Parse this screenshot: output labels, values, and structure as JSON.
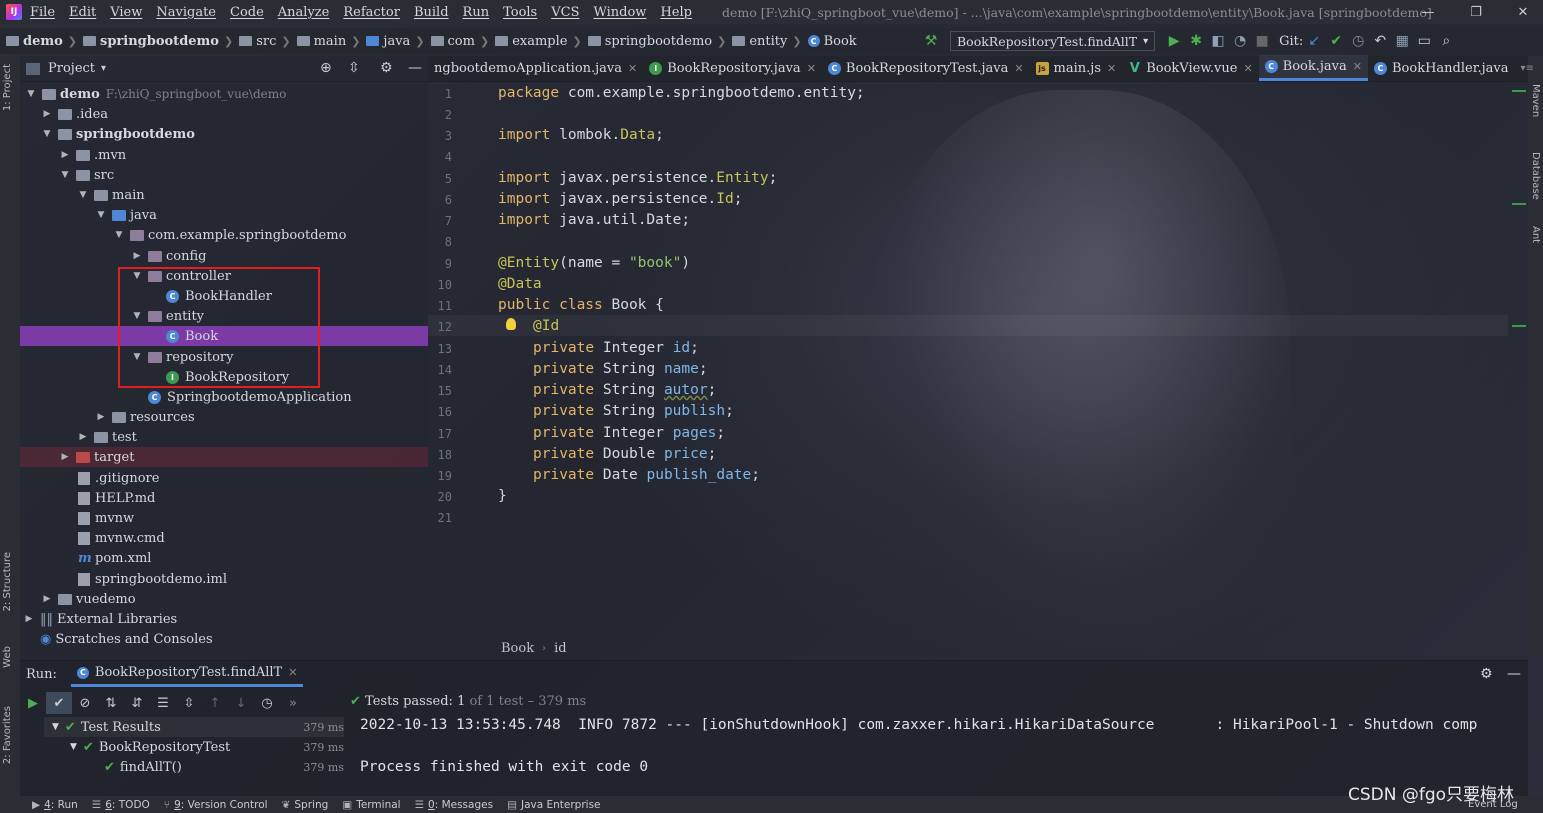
{
  "menubar": {
    "items": [
      "File",
      "Edit",
      "View",
      "Navigate",
      "Code",
      "Analyze",
      "Refactor",
      "Build",
      "Run",
      "Tools",
      "VCS",
      "Window",
      "Help"
    ],
    "window_title": "demo [F:\\zhiQ_springboot_vue\\demo] - ...\\java\\com\\example\\springbootdemo\\entity\\Book.java [springbootdemo]"
  },
  "breadcrumbs": [
    "demo",
    "springbootdemo",
    "src",
    "main",
    "java",
    "com",
    "example",
    "springbootdemo",
    "entity",
    "Book"
  ],
  "run_config": "BookRepositoryTest.findAllT",
  "git_label": "Git:",
  "project_panel": {
    "title": "Project",
    "tree": [
      {
        "label": "demo",
        "path": "F:\\zhiQ_springboot_vue\\demo",
        "arrow": "▼",
        "icon": "folder"
      },
      {
        "label": ".idea",
        "arrow": "▶",
        "icon": "folder"
      },
      {
        "label": "springbootdemo",
        "arrow": "▼",
        "icon": "folder"
      },
      {
        "label": ".mvn",
        "arrow": "▶",
        "icon": "folder"
      },
      {
        "label": "src",
        "arrow": "▼",
        "icon": "folder"
      },
      {
        "label": "main",
        "arrow": "▼",
        "icon": "folder"
      },
      {
        "label": "java",
        "arrow": "▼",
        "icon": "folder"
      },
      {
        "label": "com.example.springbootdemo",
        "arrow": "▼",
        "icon": "package"
      },
      {
        "label": "config",
        "arrow": "▶",
        "icon": "package"
      },
      {
        "label": "controller",
        "arrow": "▼",
        "icon": "package"
      },
      {
        "label": "BookHandler",
        "arrow": "",
        "icon": "C"
      },
      {
        "label": "entity",
        "arrow": "▼",
        "icon": "package"
      },
      {
        "label": "Book",
        "arrow": "",
        "icon": "C"
      },
      {
        "label": "repository",
        "arrow": "▼",
        "icon": "package"
      },
      {
        "label": "BookRepository",
        "arrow": "",
        "icon": "I"
      },
      {
        "label": "SpringbootdemoApplication",
        "arrow": "",
        "icon": "C"
      },
      {
        "label": "resources",
        "arrow": "▶",
        "icon": "folder"
      },
      {
        "label": "test",
        "arrow": "▶",
        "icon": "folder"
      },
      {
        "label": "target",
        "arrow": "▶",
        "icon": "folder"
      },
      {
        "label": ".gitignore",
        "arrow": "",
        "icon": "file"
      },
      {
        "label": "HELP.md",
        "arrow": "",
        "icon": "file"
      },
      {
        "label": "mvnw",
        "arrow": "",
        "icon": "file"
      },
      {
        "label": "mvnw.cmd",
        "arrow": "",
        "icon": "file"
      },
      {
        "label": "pom.xml",
        "arrow": "",
        "icon": "m"
      },
      {
        "label": "springbootdemo.iml",
        "arrow": "",
        "icon": "file"
      },
      {
        "label": "vuedemo",
        "arrow": "▶",
        "icon": "folder"
      },
      {
        "label": "External Libraries",
        "arrow": "▶",
        "icon": "lib"
      },
      {
        "label": "Scratches and Consoles",
        "arrow": "",
        "icon": "scratch"
      }
    ]
  },
  "editor_tabs": [
    {
      "label": "ngbootdemoApplication.java",
      "icon": ""
    },
    {
      "label": "BookRepository.java",
      "icon": "I"
    },
    {
      "label": "BookRepositoryTest.java",
      "icon": "C"
    },
    {
      "label": "main.js",
      "icon": "js"
    },
    {
      "label": "BookView.vue",
      "icon": "V"
    },
    {
      "label": "Book.java",
      "icon": "C"
    },
    {
      "label": "BookHandler.java",
      "icon": "C"
    }
  ],
  "code": {
    "line_numbers": [
      "1",
      "2",
      "3",
      "4",
      "5",
      "6",
      "7",
      "8",
      "9",
      "10",
      "11",
      "12",
      "13",
      "14",
      "15",
      "16",
      "17",
      "18",
      "19",
      "20",
      "21"
    ],
    "l1_kw": "package",
    "l1_rest": " com.example.springbootdemo.entity;",
    "l3_kw": "import",
    "l3_a": " lombok.",
    "l3_b": "Data",
    "l3_c": ";",
    "l5_kw": "import",
    "l5_a": " javax.persistence.",
    "l5_b": "Entity",
    "l5_c": ";",
    "l6_kw": "import",
    "l6_a": " javax.persistence.",
    "l6_b": "Id",
    "l6_c": ";",
    "l7_kw": "import",
    "l7_a": " java.util.Date;",
    "l9_ann": "@Entity",
    "l9_a": "(name = ",
    "l9_str": "\"book\"",
    "l9_c": ")",
    "l10_ann": "@Data",
    "l11_kw": "public class",
    "l11_a": " Book {",
    "l12_ann": "@Id",
    "fields": [
      {
        "mod": "private",
        "type": " Integer ",
        "name": "id",
        "end": ";"
      },
      {
        "mod": "private",
        "type": " String ",
        "name": "name",
        "end": ";"
      },
      {
        "mod": "private",
        "type": " String ",
        "name": "autor",
        "end": ";"
      },
      {
        "mod": "private",
        "type": " String ",
        "name": "publish",
        "end": ";"
      },
      {
        "mod": "private",
        "type": " Integer ",
        "name": "pages",
        "end": ";"
      },
      {
        "mod": "private",
        "type": " Double ",
        "name": "price",
        "end": ";"
      },
      {
        "mod": "private",
        "type": " Date ",
        "name": "publish_date",
        "end": ";"
      }
    ],
    "l20": "}"
  },
  "editor_crumbs": [
    "Book",
    "id"
  ],
  "run_panel": {
    "label": "Run:",
    "tab": "BookRepositoryTest.findAllT",
    "passed_label": "Tests passed:",
    "passed_count": "1",
    "passed_rest": "of 1 test",
    "passed_time": "– 379 ms",
    "tests": [
      {
        "label": "Test Results",
        "ms": "379 ms"
      },
      {
        "label": "BookRepositoryTest",
        "ms": "379 ms"
      },
      {
        "label": "findAllT()",
        "ms": "379 ms"
      }
    ],
    "console_line1": "2022-10-13 13:53:45.748  INFO 7872 --- [ionShutdownHook] com.zaxxer.hikari.HikariDataSource       : HikariPool-1 - Shutdown comp",
    "console_line2": "Process finished with exit code 0"
  },
  "left_strip": [
    "1: Project",
    "2: Structure",
    "Web",
    "2: Favorites"
  ],
  "right_strip": [
    "Maven",
    "Database",
    "Ant"
  ],
  "bottom_bar": [
    {
      "num": "4",
      "label": ": Run"
    },
    {
      "num": "6",
      "label": ": TODO"
    },
    {
      "num": "9",
      "label": ": Version Control"
    },
    {
      "num": "",
      "label": "Spring"
    },
    {
      "num": "",
      "label": "Terminal"
    },
    {
      "num": "0",
      "label": ": Messages"
    },
    {
      "num": "",
      "label": "Java Enterprise"
    }
  ],
  "event_log": "Event Log",
  "watermark": "CSDN @fgo只要梅林"
}
